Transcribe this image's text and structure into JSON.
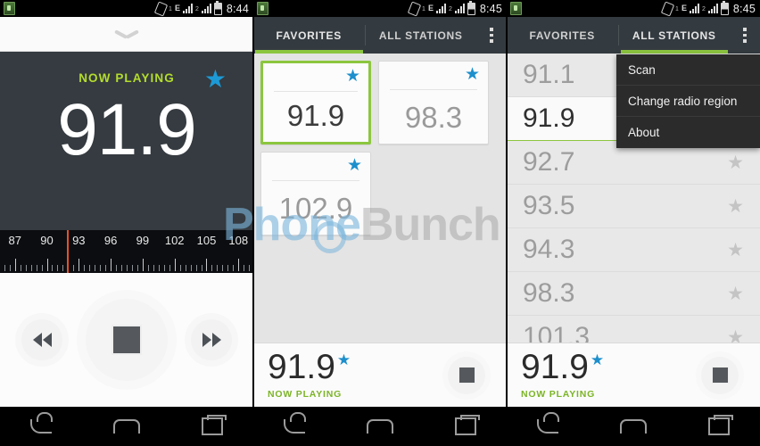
{
  "status_bar": {
    "app_icon": "app-notification-icon",
    "vibrate_icon": "vibrate-icon",
    "sim1_label": "1",
    "network_type": "E",
    "sim2_label": "2",
    "battery_icon": "battery-icon",
    "time_panel1": "8:44",
    "time_panel2": "8:45",
    "time_panel3": "8:45"
  },
  "panel1": {
    "collapse_icon": "chevron-down-icon",
    "now_playing_label": "NOW PLAYING",
    "favorite_star": "★",
    "frequency": "91.9",
    "dial": {
      "labels": [
        "87",
        "90",
        "93",
        "96",
        "99",
        "102",
        "105",
        "108"
      ],
      "needle_value": "91.9",
      "min": 87,
      "max": 108
    },
    "controls": {
      "previous": "prev-station-button",
      "stop": "stop-button",
      "next": "next-station-button"
    }
  },
  "panel2": {
    "tabs": [
      {
        "label": "FAVORITES",
        "active": true
      },
      {
        "label": "ALL STATIONS",
        "active": false
      }
    ],
    "overflow_label": "overflow-menu",
    "tiles": [
      {
        "frequency": "91.9",
        "starred": true,
        "selected": true
      },
      {
        "frequency": "98.3",
        "starred": true,
        "selected": false
      },
      {
        "frequency": "102.9",
        "starred": true,
        "selected": false
      }
    ],
    "now_playing": {
      "frequency": "91.9",
      "star": "★",
      "label": "NOW PLAYING",
      "stop_button": "stop-button"
    }
  },
  "panel3": {
    "tabs": [
      {
        "label": "FAVORITES",
        "active": false
      },
      {
        "label": "ALL STATIONS",
        "active": true
      }
    ],
    "overflow_label": "overflow-menu",
    "menu_items": [
      "Scan",
      "Change radio region",
      "About"
    ],
    "stations": [
      {
        "frequency": "91.1",
        "active": false
      },
      {
        "frequency": "91.9",
        "active": true
      },
      {
        "frequency": "92.7",
        "active": false
      },
      {
        "frequency": "93.5",
        "active": false
      },
      {
        "frequency": "94.3",
        "active": false
      },
      {
        "frequency": "98.3",
        "active": false
      },
      {
        "frequency": "101.3",
        "active": false
      }
    ],
    "now_playing": {
      "frequency": "91.9",
      "star": "★",
      "label": "NOW PLAYING",
      "stop_button": "stop-button"
    }
  },
  "nav_bar": {
    "back": "back-icon",
    "home": "home-icon",
    "recents": "recents-icon"
  },
  "watermark": {
    "part_a": "Phone",
    "part_b": "Bunch"
  },
  "colors": {
    "accent_green": "#8cc63f",
    "star_blue": "#1d8fcc",
    "panel_dark": "#353b40",
    "needle_red": "#e8502a"
  }
}
